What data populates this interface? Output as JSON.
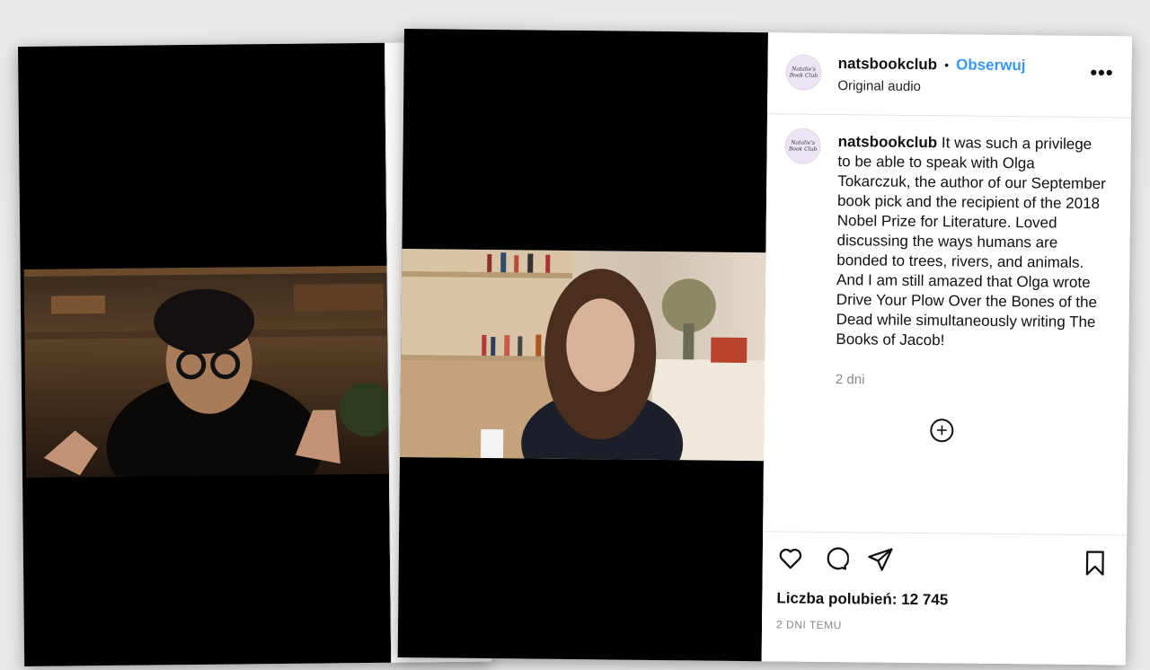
{
  "post": {
    "username": "natsbookclub",
    "separator": "•",
    "follow_label": "Obserwuj",
    "audio": "Original audio",
    "more_label": "•••",
    "avatar_text": "Natalie's Book Club",
    "caption_user": "natsbookclub",
    "caption_text": "It was such a privilege to be able to speak with Olga Tokarczuk, the author of our September book pick and the recipient of the 2018 Nobel Prize for Literature. Loved discussing the ways humans are bonded to trees, rivers, and animals. And I am still amazed that Olga wrote Drive Your Plow Over the Bones of the Dead while simultaneously writing The Books of Jacob!",
    "caption_time": "2 dni",
    "add_comment_icon": "+",
    "likes_label": "Liczba polubień: 12 745",
    "posted_ago": "2 DNI TEMU"
  },
  "icons": {
    "like": "heart-icon",
    "comment": "comment-icon",
    "share": "send-icon",
    "save": "bookmark-icon",
    "add": "plus-circle-icon",
    "more": "more-icon"
  },
  "colors": {
    "follow": "#3897f0",
    "video_bg": "#000000"
  }
}
